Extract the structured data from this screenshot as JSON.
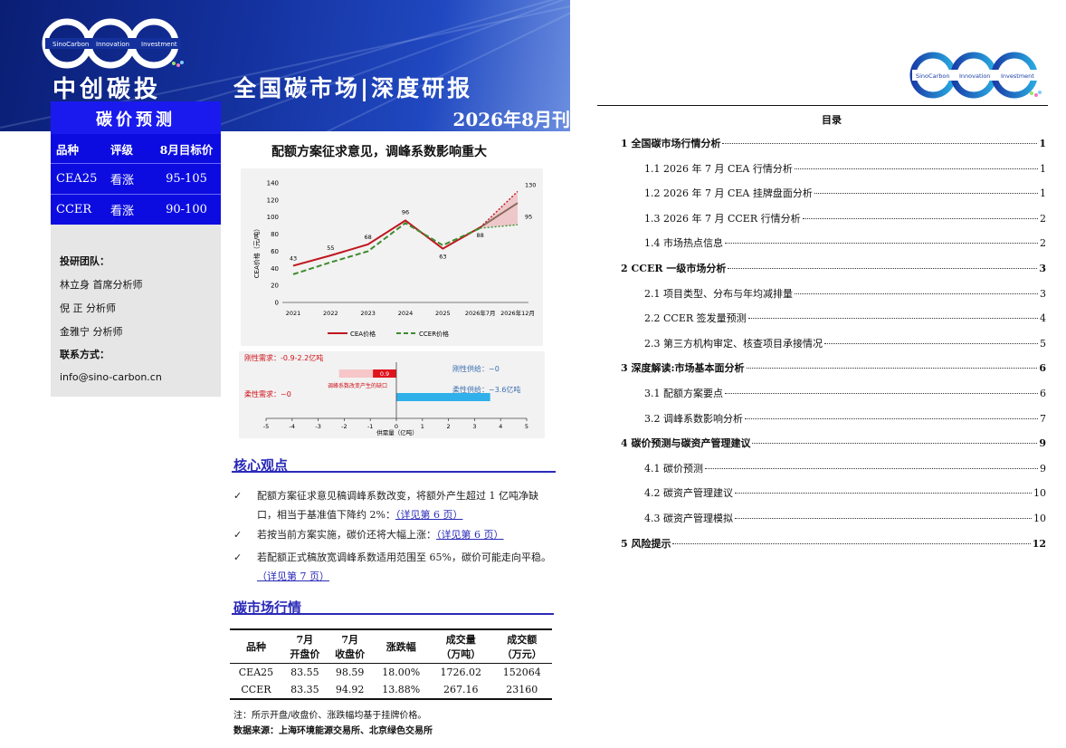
{
  "banner": {
    "logo_text": [
      "SinoCarbon",
      "Innovation",
      "Investment"
    ],
    "brand": "中创碳投",
    "title": "全国碳市场|深度研报",
    "section_label": "碳价预测",
    "issue": "2026年8月刊"
  },
  "rating_table": {
    "headers": [
      "品种",
      "评级",
      "8月目标价"
    ],
    "rows": [
      [
        "CEA25",
        "看涨",
        "95-105"
      ],
      [
        "CCER",
        "看涨",
        "90-100"
      ]
    ]
  },
  "team": {
    "heading": "投研团队：",
    "members": [
      "林立身  首席分析师",
      "倪   正  分析师",
      "金雅宁  分析师"
    ],
    "contact_heading": "联系方式：",
    "email": "info@sino-carbon.cn"
  },
  "headline": "配额方案征求意见，调峰系数影响重大",
  "chart_data": [
    {
      "type": "line",
      "x": [
        "2021",
        "2022",
        "2023",
        "2024",
        "2025",
        "2026年7月",
        "2026年12月"
      ],
      "ylabel": "CEA价格（元/吨）",
      "ylim": [
        0,
        140
      ],
      "yticks": [
        0,
        20,
        40,
        60,
        80,
        100,
        120,
        140
      ],
      "series": [
        {
          "name": "CEA价格",
          "values": [
            43,
            55,
            68,
            96,
            63,
            88,
            130
          ],
          "color": "#c0161e"
        },
        {
          "name": "CCER价格",
          "values": [
            33,
            47,
            60,
            93,
            67,
            87,
            91
          ],
          "color": "#3e8b2e"
        }
      ],
      "labels": [
        {
          "x": "2021",
          "text": "43"
        },
        {
          "x": "2022",
          "text": "55"
        },
        {
          "x": "2023",
          "text": "68"
        },
        {
          "x": "2024",
          "text": "96"
        },
        {
          "x": "2025",
          "text": "63"
        },
        {
          "x": "2026年7月",
          "text": "88"
        },
        {
          "x": "2026年12月",
          "text": "130"
        },
        {
          "x": "2026年12月",
          "text": "95"
        }
      ],
      "legend": [
        "CEA价格",
        "CCER价格"
      ],
      "legend_position": "bottom"
    },
    {
      "type": "bar",
      "xlabel": "供需量（亿吨）",
      "xlim": [
        -5,
        5
      ],
      "xticks": [
        -5,
        -4,
        -3,
        -2,
        -1,
        0,
        1,
        2,
        3,
        4,
        5
      ],
      "bars": [
        {
          "label": "0.9",
          "range": [
            -0.9,
            0
          ],
          "color": "#e0141c"
        },
        {
          "label": "",
          "range": [
            -2.2,
            -0.9
          ],
          "color": "#f6c6c8"
        },
        {
          "label": "",
          "range": [
            0,
            3.6
          ],
          "color": "#2fb0ea"
        }
      ],
      "annotations": {
        "rigid_demand": "刚性需求：-0.9-2.2亿吨",
        "flexible_demand": "柔性需求：~0",
        "rigid_supply": "刚性供给：~0",
        "flexible_supply": "柔性供给：~3.6亿吨",
        "note": "调峰系数改变产生的缺口"
      }
    }
  ],
  "core": {
    "title": "核心观点",
    "points": [
      {
        "text": "配额方案征求意见稿调峰系数改变，将额外产生超过 1 亿吨净缺口，相当于基准值下降约 2%：",
        "link": "（详见第 6 页）"
      },
      {
        "text": "若按当前方案实施，碳价还将大幅上涨：",
        "link": "（详见第 6 页）"
      },
      {
        "text": "若配额正式稿放宽调峰系数适用范围至 65%，碳价可能走向平稳。",
        "link": "（详见第 7 页）"
      }
    ]
  },
  "market": {
    "title": "碳市场行情",
    "headers": [
      "品种",
      "7月\n开盘价",
      "7月\n收盘价",
      "涨跌幅",
      "成交量\n（万吨）",
      "成交额\n（万元）"
    ],
    "rows": [
      [
        "CEA25",
        "83.55",
        "98.59",
        "18.00%",
        "1726.02",
        "152064"
      ],
      [
        "CCER",
        "83.35",
        "94.92",
        "13.88%",
        "267.16",
        "23160"
      ]
    ],
    "note": "注：所示开盘/收盘价、涨跌幅均基于挂牌价格。",
    "source": "数据来源：上海环境能源交易所、北京绿色交易所"
  },
  "toc": {
    "title": "目录",
    "entries": [
      {
        "level": 1,
        "text": "1  全国碳市场行情分析",
        "page": "1"
      },
      {
        "level": 2,
        "text": "1.1 2026 年 7 月 CEA 行情分析",
        "page": "1"
      },
      {
        "level": 2,
        "text": "1.2 2026 年 7 月 CEA 挂牌盘面分析",
        "page": "1"
      },
      {
        "level": 2,
        "text": "1.3 2026 年 7 月 CCER 行情分析",
        "page": "2"
      },
      {
        "level": 2,
        "text": "1.4  市场热点信息",
        "page": "2"
      },
      {
        "level": 1,
        "text": "2 CCER 一级市场分析",
        "page": "3"
      },
      {
        "level": 2,
        "text": "2.1  项目类型、分布与年均减排量",
        "page": "3"
      },
      {
        "level": 2,
        "text": "2.2 CCER 签发量预测",
        "page": "4"
      },
      {
        "level": 2,
        "text": "2.3  第三方机构审定、核查项目承接情况",
        "page": "5"
      },
      {
        "level": 1,
        "text": "3  深度解读:市场基本面分析",
        "page": "6"
      },
      {
        "level": 2,
        "text": "3.1  配额方案要点",
        "page": "6"
      },
      {
        "level": 2,
        "text": "3.2  调峰系数影响分析",
        "page": "7"
      },
      {
        "level": 1,
        "text": "4  碳价预测与碳资产管理建议",
        "page": "9"
      },
      {
        "level": 2,
        "text": "4.1  碳价预测",
        "page": "9"
      },
      {
        "level": 2,
        "text": "4.2  碳资产管理建议",
        "page": "10"
      },
      {
        "level": 2,
        "text": "4.3  碳资产管理模拟",
        "page": "10"
      },
      {
        "level": 1,
        "text": "5  风险提示",
        "page": "12"
      }
    ]
  },
  "colors": {
    "banner": "#13309c",
    "accent_blue": "#1a1aef",
    "section_blue": "#2a2ab8",
    "cea_red": "#c0161e",
    "ccer_green": "#3e8b2e"
  }
}
